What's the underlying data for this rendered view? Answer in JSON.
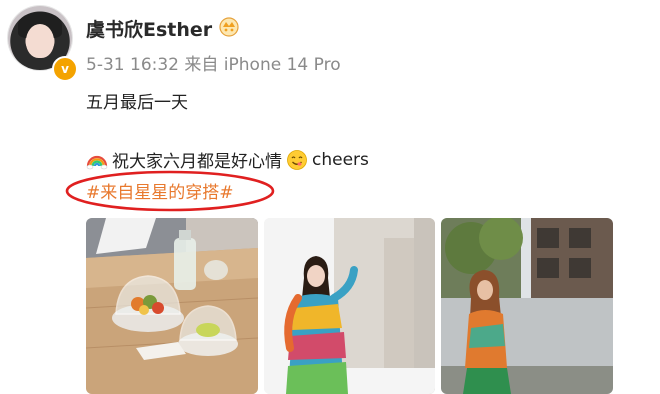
{
  "post": {
    "author_name": "虞书欣Esther",
    "date": "5-31",
    "time": "16:32",
    "source": "来自 iPhone 14 Pro",
    "line1": "五月最后一天",
    "line2_text": "祝大家六月都是好心情",
    "line2_suffix": "cheers",
    "hashtag": "#来自星星的穿搭#"
  },
  "icons": {
    "verified": "verified-v-icon",
    "name_badge": "member-crown-icon",
    "rainbow": "rainbow-emoji-icon",
    "yum": "yum-emoji-icon"
  },
  "verified_mark": "v",
  "colors": {
    "hashtag": "#e8792e",
    "annotation_circle": "#e02020",
    "meta": "#8a8a8a",
    "verified": "#f4a300"
  },
  "photos": [
    {
      "subject": "table-with-glass-domes"
    },
    {
      "subject": "woman-in-colorful-dress-indoors"
    },
    {
      "subject": "woman-in-colorful-dress-outdoors"
    }
  ]
}
